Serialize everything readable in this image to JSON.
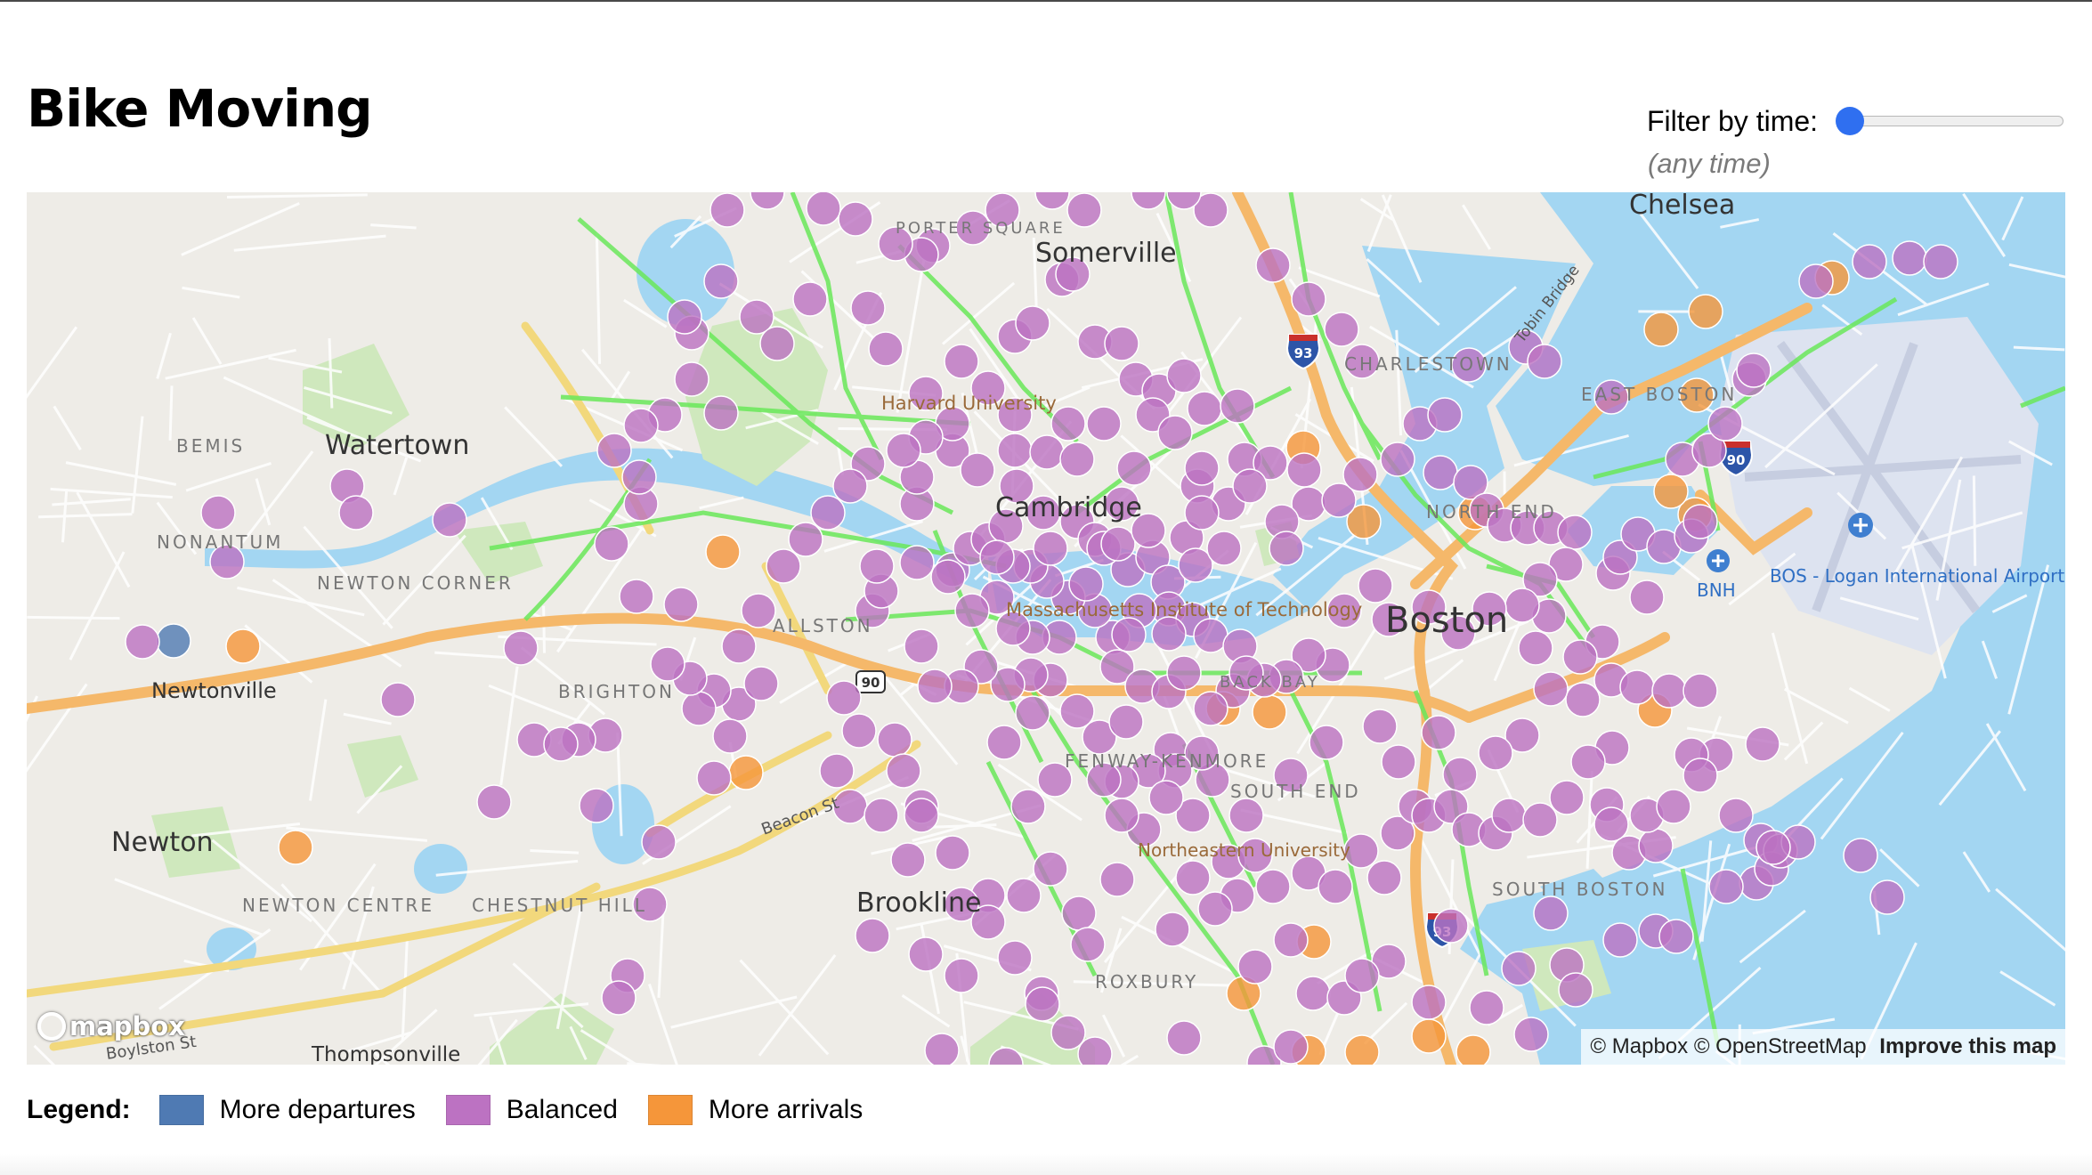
{
  "page": {
    "title": "Bike Moving"
  },
  "filter": {
    "label": "Filter by time:",
    "readout": "(any time)",
    "slider_value": 0
  },
  "colors": {
    "departures": "#4f7ab3",
    "balanced": "#bc72c2",
    "arrivals": "#f5963a",
    "water": "#a3d6f2",
    "land": "#eeece7",
    "park": "#cfe8bd",
    "bike_lane": "#6ae85a",
    "highway": "#f5b86a",
    "arterial": "#f2d87c"
  },
  "map": {
    "places": [
      "Watertown",
      "Somerville",
      "Cambridge",
      "Newtonville",
      "Newton",
      "Brookline",
      "Boston",
      "Chelsea",
      "Thompsonville"
    ],
    "neighborhoods": [
      "BEMIS",
      "NONANTUM",
      "NEWTON CORNER",
      "BRIGHTON",
      "ALLSTON",
      "NEWTON CENTRE",
      "CHESTNUT HILL",
      "FENWAY-KENMORE",
      "SOUTH END",
      "ROXBURY",
      "SOUTH BOSTON",
      "CHARLESTOWN",
      "EAST BOSTON",
      "NORTH END",
      "PORTER SQUARE",
      "BACK BAY"
    ],
    "pois": [
      "Harvard University",
      "Massachusetts Institute of Technology",
      "Northeastern University",
      "BOS - Logan International Airport",
      "BNH"
    ],
    "streets": [
      "Beacon St",
      "Boylston St",
      "Tobin Bridge"
    ],
    "shields": [
      "93",
      "93",
      "90",
      "90"
    ],
    "attribution": {
      "mapbox": "© Mapbox",
      "osm": "© OpenStreetMap",
      "improve": "Improve this map"
    },
    "logo": "mapbox"
  },
  "legend": {
    "title": "Legend:",
    "items": [
      {
        "label": "More departures",
        "color": "#4f7ab3"
      },
      {
        "label": "Balanced",
        "color": "#bc72c2"
      },
      {
        "label": "More arrivals",
        "color": "#f5963a"
      }
    ]
  }
}
